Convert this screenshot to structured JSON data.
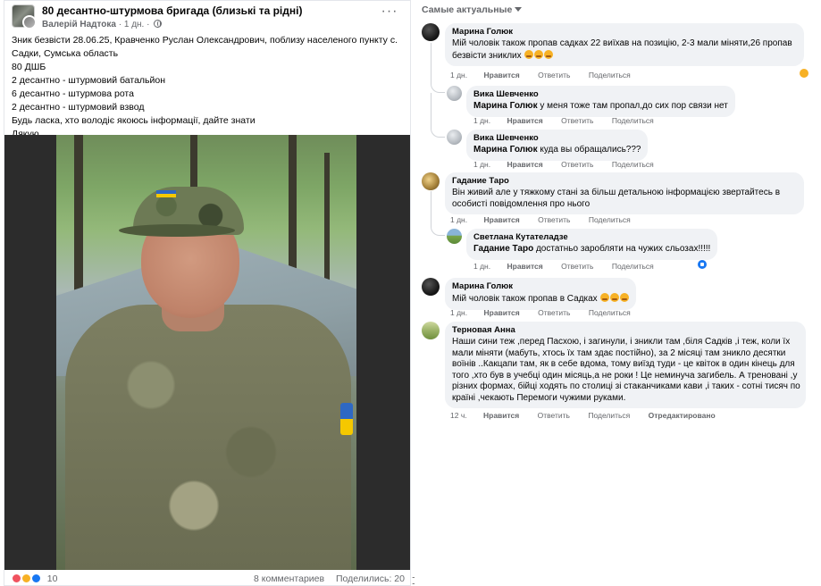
{
  "post": {
    "group_name": "80 десантно-штурмова бригада (близькі та рідні)",
    "author": "Валерій Надтока",
    "time": "1 дн.",
    "separator": "·",
    "lines": [
      "Зник безвісти 28.06.25, Кравченко Руслан Олександрович, поблизу населеного пункту с.",
      "Садки, Сумська область",
      "80 ДШБ",
      "2 десантно - штурмовий батальйон",
      "6 десантно - штурмова рота",
      "2 десантно - штурмовий взвод",
      "Будь ласка, хто володіє якоюсь інформації, дайте знати",
      "Дякую"
    ],
    "reaction_count": "10",
    "comments_count": "8 комментариев",
    "shares": "Поделились: 20"
  },
  "comments_panel": {
    "sort_label": "Самые актуальные",
    "action_like": "Нравится",
    "action_reply": "Ответить",
    "action_share": "Поделиться",
    "comments": [
      {
        "author": "Марина Голюк",
        "lines": [
          "Мій чоловік також пропав садках 22 виїхав на позицію, 2-3 мали міняти,26 пропав",
          "безвісти зниклих"
        ],
        "time": "1 дн."
      },
      {
        "author": "Вика Шевченко",
        "mention": "Марина Голюк",
        "text": " у меня тоже там пропал,до сих пор связи нет",
        "time": "1 дн."
      },
      {
        "author": "Вика Шевченко",
        "mention": "Марина Голюк",
        "text": " куда вы обращались???",
        "time": "1 дн."
      },
      {
        "author": "Гадание Таро",
        "lines": [
          "Він живий але у тяжкому стані за більш детальною інформацією звертайтесь в",
          "особисті повідомлення про нього"
        ],
        "time": "1 дн."
      },
      {
        "author": "Светлана Кутателадзе",
        "mention": "Гадание Таро",
        "text": " достатньо заробляти на чужих сльозах!!!!!",
        "time": "1 дн."
      },
      {
        "author": "Марина Голюк",
        "text": "Мій чоловік також пропав в Садках",
        "time": "1 дн."
      },
      {
        "author": "Терновая Анна",
        "lines": [
          "Наши сини теж ,перед Пасхою, і загинули, і зникли там ,біля Садків ,і теж, коли їх",
          "мали міняти (мабуть, хтось їх там здає постійно), за 2 місяці там зникло десятки",
          "воїнів ..Какцапи там, як в себе вдома, тому виїзд туди - це квіток в один кінець для",
          "того ,хто був в учебці один місяць,а не роки ! Це неминуча загибель. А треновані ,у",
          "різних формах, бійці ходять по столиці зі стаканчиками кави ,і таких - сотні тисяч по",
          "країні ,чекають Перемоги чужими руками."
        ],
        "time": "12 ч.",
        "edited": "Отредактировано"
      }
    ]
  },
  "colors": {
    "bubble": "#f0f2f5",
    "meta": "#65676b",
    "like_blue": "#1877f2"
  }
}
